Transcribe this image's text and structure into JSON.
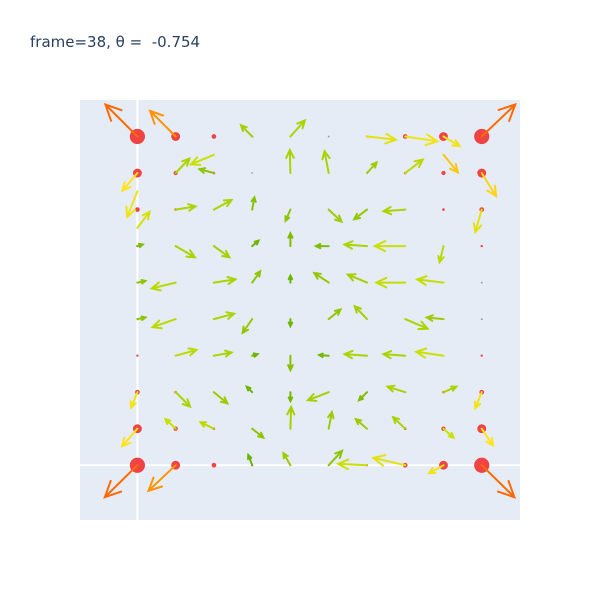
{
  "chart_data": {
    "type": "vector-field",
    "title": "frame=38, θ =  -0.754",
    "xlabel": "",
    "ylabel": "",
    "xlim": [
      -1.5,
      10.0
    ],
    "ylim": [
      -1.5,
      10.0
    ],
    "grid": true,
    "tick_labels": false,
    "background": "#e5ecf6",
    "node_color": "#ef4444",
    "color_scale": [
      "#4aa800",
      "#8fc400",
      "#c9e000",
      "#ffe41a",
      "#ffa400",
      "#ff6a00"
    ],
    "nodes": [
      {
        "x": 0,
        "y": 0,
        "w": 1.0
      },
      {
        "x": 1,
        "y": 0,
        "w": 0.55
      },
      {
        "x": 2,
        "y": 0,
        "w": 0.25
      },
      {
        "x": 3,
        "y": 0,
        "w": 0.08
      },
      {
        "x": 4,
        "y": 0,
        "w": 0.05
      },
      {
        "x": 5,
        "y": 0,
        "w": 0.05
      },
      {
        "x": 6,
        "y": 0,
        "w": 0.08
      },
      {
        "x": 7,
        "y": 0,
        "w": 0.25
      },
      {
        "x": 8,
        "y": 0,
        "w": 0.55
      },
      {
        "x": 9,
        "y": 0,
        "w": 1.0
      },
      {
        "x": 0,
        "y": 1,
        "w": 0.55
      },
      {
        "x": 1,
        "y": 1,
        "w": 0.22
      },
      {
        "x": 2,
        "y": 1,
        "w": 0.1
      },
      {
        "x": 3,
        "y": 1,
        "w": 0.04
      },
      {
        "x": 4,
        "y": 1,
        "w": 0.03
      },
      {
        "x": 5,
        "y": 1,
        "w": 0.03
      },
      {
        "x": 6,
        "y": 1,
        "w": 0.04
      },
      {
        "x": 7,
        "y": 1,
        "w": 0.1
      },
      {
        "x": 8,
        "y": 1,
        "w": 0.22
      },
      {
        "x": 9,
        "y": 1,
        "w": 0.55
      },
      {
        "x": 0,
        "y": 2,
        "w": 0.25
      },
      {
        "x": 1,
        "y": 2,
        "w": 0.1
      },
      {
        "x": 2,
        "y": 2,
        "w": 0.05
      },
      {
        "x": 3,
        "y": 2,
        "w": 0.03
      },
      {
        "x": 4,
        "y": 2,
        "w": 0.02
      },
      {
        "x": 5,
        "y": 2,
        "w": 0.02
      },
      {
        "x": 6,
        "y": 2,
        "w": 0.03
      },
      {
        "x": 7,
        "y": 2,
        "w": 0.05
      },
      {
        "x": 8,
        "y": 2,
        "w": 0.1
      },
      {
        "x": 9,
        "y": 2,
        "w": 0.25
      },
      {
        "x": 0,
        "y": 3,
        "w": 0.08
      },
      {
        "x": 1,
        "y": 3,
        "w": 0.04
      },
      {
        "x": 2,
        "y": 3,
        "w": 0.03
      },
      {
        "x": 3,
        "y": 3,
        "w": 0.02
      },
      {
        "x": 4,
        "y": 3,
        "w": 0.02
      },
      {
        "x": 5,
        "y": 3,
        "w": 0.02
      },
      {
        "x": 6,
        "y": 3,
        "w": 0.02
      },
      {
        "x": 7,
        "y": 3,
        "w": 0.03
      },
      {
        "x": 8,
        "y": 3,
        "w": 0.04
      },
      {
        "x": 9,
        "y": 3,
        "w": 0.08
      },
      {
        "x": 0,
        "y": 4,
        "w": 0.05
      },
      {
        "x": 1,
        "y": 4,
        "w": 0.03
      },
      {
        "x": 2,
        "y": 4,
        "w": 0.02
      },
      {
        "x": 3,
        "y": 4,
        "w": 0.02
      },
      {
        "x": 4,
        "y": 4,
        "w": 0.02
      },
      {
        "x": 5,
        "y": 4,
        "w": 0.02
      },
      {
        "x": 6,
        "y": 4,
        "w": 0.02
      },
      {
        "x": 7,
        "y": 4,
        "w": 0.02
      },
      {
        "x": 8,
        "y": 4,
        "w": 0.03
      },
      {
        "x": 9,
        "y": 4,
        "w": 0.05
      },
      {
        "x": 0,
        "y": 5,
        "w": 0.05
      },
      {
        "x": 1,
        "y": 5,
        "w": 0.03
      },
      {
        "x": 2,
        "y": 5,
        "w": 0.02
      },
      {
        "x": 3,
        "y": 5,
        "w": 0.02
      },
      {
        "x": 4,
        "y": 5,
        "w": 0.02
      },
      {
        "x": 5,
        "y": 5,
        "w": 0.02
      },
      {
        "x": 6,
        "y": 5,
        "w": 0.02
      },
      {
        "x": 7,
        "y": 5,
        "w": 0.02
      },
      {
        "x": 8,
        "y": 5,
        "w": 0.03
      },
      {
        "x": 9,
        "y": 5,
        "w": 0.05
      },
      {
        "x": 0,
        "y": 6,
        "w": 0.08
      },
      {
        "x": 1,
        "y": 6,
        "w": 0.04
      },
      {
        "x": 2,
        "y": 6,
        "w": 0.03
      },
      {
        "x": 3,
        "y": 6,
        "w": 0.02
      },
      {
        "x": 4,
        "y": 6,
        "w": 0.02
      },
      {
        "x": 5,
        "y": 6,
        "w": 0.02
      },
      {
        "x": 6,
        "y": 6,
        "w": 0.02
      },
      {
        "x": 7,
        "y": 6,
        "w": 0.03
      },
      {
        "x": 8,
        "y": 6,
        "w": 0.04
      },
      {
        "x": 9,
        "y": 6,
        "w": 0.08
      },
      {
        "x": 0,
        "y": 7,
        "w": 0.25
      },
      {
        "x": 1,
        "y": 7,
        "w": 0.1
      },
      {
        "x": 2,
        "y": 7,
        "w": 0.05
      },
      {
        "x": 3,
        "y": 7,
        "w": 0.03
      },
      {
        "x": 4,
        "y": 7,
        "w": 0.02
      },
      {
        "x": 5,
        "y": 7,
        "w": 0.02
      },
      {
        "x": 6,
        "y": 7,
        "w": 0.03
      },
      {
        "x": 7,
        "y": 7,
        "w": 0.05
      },
      {
        "x": 8,
        "y": 7,
        "w": 0.1
      },
      {
        "x": 9,
        "y": 7,
        "w": 0.25
      },
      {
        "x": 0,
        "y": 8,
        "w": 0.55
      },
      {
        "x": 1,
        "y": 8,
        "w": 0.22
      },
      {
        "x": 2,
        "y": 8,
        "w": 0.1
      },
      {
        "x": 3,
        "y": 8,
        "w": 0.04
      },
      {
        "x": 4,
        "y": 8,
        "w": 0.03
      },
      {
        "x": 5,
        "y": 8,
        "w": 0.03
      },
      {
        "x": 6,
        "y": 8,
        "w": 0.04
      },
      {
        "x": 7,
        "y": 8,
        "w": 0.1
      },
      {
        "x": 8,
        "y": 8,
        "w": 0.22
      },
      {
        "x": 9,
        "y": 8,
        "w": 0.55
      },
      {
        "x": 0,
        "y": 9,
        "w": 1.0
      },
      {
        "x": 1,
        "y": 9,
        "w": 0.55
      },
      {
        "x": 2,
        "y": 9,
        "w": 0.25
      },
      {
        "x": 3,
        "y": 9,
        "w": 0.08
      },
      {
        "x": 4,
        "y": 9,
        "w": 0.05
      },
      {
        "x": 5,
        "y": 9,
        "w": 0.05
      },
      {
        "x": 6,
        "y": 9,
        "w": 0.08
      },
      {
        "x": 7,
        "y": 9,
        "w": 0.25
      },
      {
        "x": 8,
        "y": 9,
        "w": 0.55
      },
      {
        "x": 9,
        "y": 9,
        "w": 1.0
      }
    ],
    "arrows": [
      {
        "x": 0,
        "y": 0,
        "u": -1.02,
        "v": -1.0,
        "m": 1.0
      },
      {
        "x": 1,
        "y": 0,
        "u": -0.85,
        "v": -0.8,
        "m": 0.86
      },
      {
        "x": 9,
        "y": 0,
        "u": 1.02,
        "v": -1.0,
        "m": 1.0
      },
      {
        "x": 8,
        "y": 0,
        "u": -0.45,
        "v": -0.25,
        "m": 0.55
      },
      {
        "x": 7,
        "y": 0,
        "u": -1.0,
        "v": 0.23,
        "m": 0.5
      },
      {
        "x": 6,
        "y": 0,
        "u": -0.9,
        "v": 0.04,
        "m": 0.4
      },
      {
        "x": 5,
        "y": 0,
        "u": 0.42,
        "v": 0.45,
        "m": 0.2
      },
      {
        "x": 4,
        "y": 0,
        "u": -0.22,
        "v": 0.38,
        "m": 0.25
      },
      {
        "x": 3,
        "y": 0,
        "u": -0.12,
        "v": 0.32,
        "m": 0.1
      },
      {
        "x": 0,
        "y": 1,
        "u": -0.48,
        "v": -0.55,
        "m": 0.6
      },
      {
        "x": 1,
        "y": 1,
        "u": -0.32,
        "v": 0.3,
        "m": 0.4
      },
      {
        "x": 2,
        "y": 1,
        "u": -0.42,
        "v": 0.2,
        "m": 0.35
      },
      {
        "x": 3,
        "y": 1,
        "u": 0.35,
        "v": -0.28,
        "m": 0.2
      },
      {
        "x": 4,
        "y": 1,
        "u": 0.02,
        "v": 0.68,
        "m": 0.28
      },
      {
        "x": 5,
        "y": 1,
        "u": 0.1,
        "v": 0.52,
        "m": 0.25
      },
      {
        "x": 6,
        "y": 1,
        "u": -0.35,
        "v": 0.3,
        "m": 0.25
      },
      {
        "x": 7,
        "y": 1,
        "u": -0.38,
        "v": 0.36,
        "m": 0.3
      },
      {
        "x": 8,
        "y": 1,
        "u": 0.32,
        "v": -0.28,
        "m": 0.4
      },
      {
        "x": 9,
        "y": 1,
        "u": 0.35,
        "v": -0.52,
        "m": 0.6
      },
      {
        "x": 0,
        "y": 2,
        "u": -0.2,
        "v": -0.48,
        "m": 0.55
      },
      {
        "x": 1,
        "y": 2,
        "u": 0.45,
        "v": -0.45,
        "m": 0.3
      },
      {
        "x": 2,
        "y": 2,
        "u": 0.42,
        "v": -0.35,
        "m": 0.25
      },
      {
        "x": 3,
        "y": 2,
        "u": -0.17,
        "v": 0.17,
        "m": 0.1
      },
      {
        "x": 4,
        "y": 2,
        "u": 0.0,
        "v": -0.28,
        "m": 0.12
      },
      {
        "x": 5,
        "y": 2,
        "u": -0.65,
        "v": -0.25,
        "m": 0.28
      },
      {
        "x": 6,
        "y": 2,
        "u": -0.25,
        "v": -0.25,
        "m": 0.15
      },
      {
        "x": 7,
        "y": 2,
        "u": -0.55,
        "v": 0.17,
        "m": 0.3
      },
      {
        "x": 8,
        "y": 2,
        "u": 0.4,
        "v": 0.17,
        "m": 0.3
      },
      {
        "x": 9,
        "y": 2,
        "u": -0.2,
        "v": -0.5,
        "m": 0.55
      },
      {
        "x": 1,
        "y": 3,
        "u": 0.65,
        "v": 0.18,
        "m": 0.35
      },
      {
        "x": 2,
        "y": 3,
        "u": 0.55,
        "v": 0.1,
        "m": 0.3
      },
      {
        "x": 3,
        "y": 3,
        "u": 0.17,
        "v": 0.05,
        "m": 0.1
      },
      {
        "x": 4,
        "y": 3,
        "u": 0.0,
        "v": -0.45,
        "m": 0.18
      },
      {
        "x": 5,
        "y": 3,
        "u": -0.3,
        "v": 0.02,
        "m": 0.12
      },
      {
        "x": 6,
        "y": 3,
        "u": -0.7,
        "v": 0.05,
        "m": 0.3
      },
      {
        "x": 7,
        "y": 3,
        "u": -0.68,
        "v": 0.05,
        "m": 0.3
      },
      {
        "x": 8,
        "y": 3,
        "u": -0.85,
        "v": 0.12,
        "m": 0.4
      },
      {
        "x": 0,
        "y": 4,
        "u": 0.25,
        "v": 0.05,
        "m": 0.2
      },
      {
        "x": 1,
        "y": 4,
        "u": -0.72,
        "v": -0.25,
        "m": 0.35
      },
      {
        "x": 2,
        "y": 4,
        "u": 0.63,
        "v": 0.17,
        "m": 0.3
      },
      {
        "x": 3,
        "y": 4,
        "u": -0.3,
        "v": -0.43,
        "m": 0.22
      },
      {
        "x": 4,
        "y": 4,
        "u": 0.0,
        "v": -0.22,
        "m": 0.1
      },
      {
        "x": 5,
        "y": 4,
        "u": 0.37,
        "v": 0.3,
        "m": 0.22
      },
      {
        "x": 6,
        "y": 4,
        "u": -0.38,
        "v": 0.4,
        "m": 0.28
      },
      {
        "x": 7,
        "y": 4,
        "u": 0.7,
        "v": -0.3,
        "m": 0.3
      },
      {
        "x": 8,
        "y": 4,
        "u": -0.52,
        "v": 0.05,
        "m": 0.25
      },
      {
        "x": 0,
        "y": 5,
        "u": 0.25,
        "v": 0.05,
        "m": 0.2
      },
      {
        "x": 1,
        "y": 5,
        "u": -0.75,
        "v": -0.18,
        "m": 0.35
      },
      {
        "x": 2,
        "y": 5,
        "u": 0.67,
        "v": 0.1,
        "m": 0.3
      },
      {
        "x": 3,
        "y": 5,
        "u": 0.25,
        "v": 0.35,
        "m": 0.2
      },
      {
        "x": 4,
        "y": 5,
        "u": 0.0,
        "v": 0.22,
        "m": 0.1
      },
      {
        "x": 5,
        "y": 5,
        "u": -0.45,
        "v": 0.3,
        "m": 0.22
      },
      {
        "x": 6,
        "y": 5,
        "u": -0.6,
        "v": 0.25,
        "m": 0.28
      },
      {
        "x": 7,
        "y": 5,
        "u": -0.9,
        "v": 0.0,
        "m": 0.38
      },
      {
        "x": 8,
        "y": 5,
        "u": -0.82,
        "v": 0.1,
        "m": 0.38
      },
      {
        "x": 0,
        "y": 6,
        "u": 0.17,
        "v": 0.05,
        "m": 0.15
      },
      {
        "x": 1,
        "y": 6,
        "u": 0.6,
        "v": -0.35,
        "m": 0.3
      },
      {
        "x": 2,
        "y": 6,
        "u": 0.48,
        "v": -0.35,
        "m": 0.28
      },
      {
        "x": 3,
        "y": 6,
        "u": 0.2,
        "v": 0.17,
        "m": 0.1
      },
      {
        "x": 4,
        "y": 6,
        "u": 0.0,
        "v": 0.4,
        "m": 0.15
      },
      {
        "x": 5,
        "y": 6,
        "u": -0.4,
        "v": 0.0,
        "m": 0.15
      },
      {
        "x": 6,
        "y": 6,
        "u": -0.7,
        "v": 0.05,
        "m": 0.3
      },
      {
        "x": 7,
        "y": 6,
        "u": -0.95,
        "v": 0.0,
        "m": 0.4
      },
      {
        "x": 8,
        "y": 6,
        "u": -0.12,
        "v": -0.5,
        "m": 0.35
      },
      {
        "x": 0,
        "y": 6.5,
        "u": 0.38,
        "v": 0.5,
        "m": 0.45
      },
      {
        "x": 1,
        "y": 7,
        "u": 0.62,
        "v": 0.1,
        "m": 0.3
      },
      {
        "x": 2,
        "y": 7,
        "u": 0.55,
        "v": 0.3,
        "m": 0.3
      },
      {
        "x": 3,
        "y": 7,
        "u": 0.07,
        "v": 0.38,
        "m": 0.18
      },
      {
        "x": 4,
        "y": 7,
        "u": -0.15,
        "v": -0.35,
        "m": 0.2
      },
      {
        "x": 5,
        "y": 7,
        "u": 0.4,
        "v": -0.38,
        "m": 0.25
      },
      {
        "x": 6,
        "y": 7,
        "u": -0.4,
        "v": -0.3,
        "m": 0.22
      },
      {
        "x": 7,
        "y": 7,
        "u": -0.68,
        "v": -0.05,
        "m": 0.3
      },
      {
        "x": 9,
        "y": 7,
        "u": -0.2,
        "v": -0.7,
        "m": 0.5
      },
      {
        "x": 0,
        "y": 7.5,
        "u": -0.32,
        "v": -0.8,
        "m": 0.55
      },
      {
        "x": 1,
        "y": 8,
        "u": 0.43,
        "v": 0.45,
        "m": 0.3
      },
      {
        "x": 2,
        "y": 8,
        "u": -0.45,
        "v": 0.12,
        "m": 0.2
      },
      {
        "x": 4,
        "y": 8,
        "u": -0.02,
        "v": 0.72,
        "m": 0.3
      },
      {
        "x": 5,
        "y": 8,
        "u": -0.13,
        "v": 0.68,
        "m": 0.3
      },
      {
        "x": 6,
        "y": 8,
        "u": 0.3,
        "v": 0.33,
        "m": 0.25
      },
      {
        "x": 7,
        "y": 8,
        "u": 0.55,
        "v": 0.42,
        "m": 0.35
      },
      {
        "x": 8,
        "y": 8.5,
        "u": 0.45,
        "v": -0.55,
        "m": 0.7
      },
      {
        "x": 0,
        "y": 8,
        "u": -0.47,
        "v": -0.55,
        "m": 0.6
      },
      {
        "x": 9,
        "y": 8,
        "u": 0.45,
        "v": -0.72,
        "m": 0.65
      },
      {
        "x": 2,
        "y": 8.5,
        "u": -0.72,
        "v": -0.3,
        "m": 0.4
      },
      {
        "x": 3,
        "y": 9,
        "u": -0.35,
        "v": 0.35,
        "m": 0.28
      },
      {
        "x": 4,
        "y": 9,
        "u": 0.45,
        "v": 0.5,
        "m": 0.3
      },
      {
        "x": 6,
        "y": 9,
        "u": 0.9,
        "v": -0.1,
        "m": 0.5
      },
      {
        "x": 7,
        "y": 9,
        "u": 1.0,
        "v": -0.15,
        "m": 0.55
      },
      {
        "x": 8,
        "y": 9,
        "u": 0.5,
        "v": -0.3,
        "m": 0.55
      },
      {
        "x": 0,
        "y": 9,
        "u": -1.0,
        "v": 1.0,
        "m": 1.0
      },
      {
        "x": 1,
        "y": 9,
        "u": -0.8,
        "v": 0.8,
        "m": 0.86
      },
      {
        "x": 9,
        "y": 9,
        "u": 1.05,
        "v": 1.0,
        "m": 1.0
      }
    ]
  }
}
